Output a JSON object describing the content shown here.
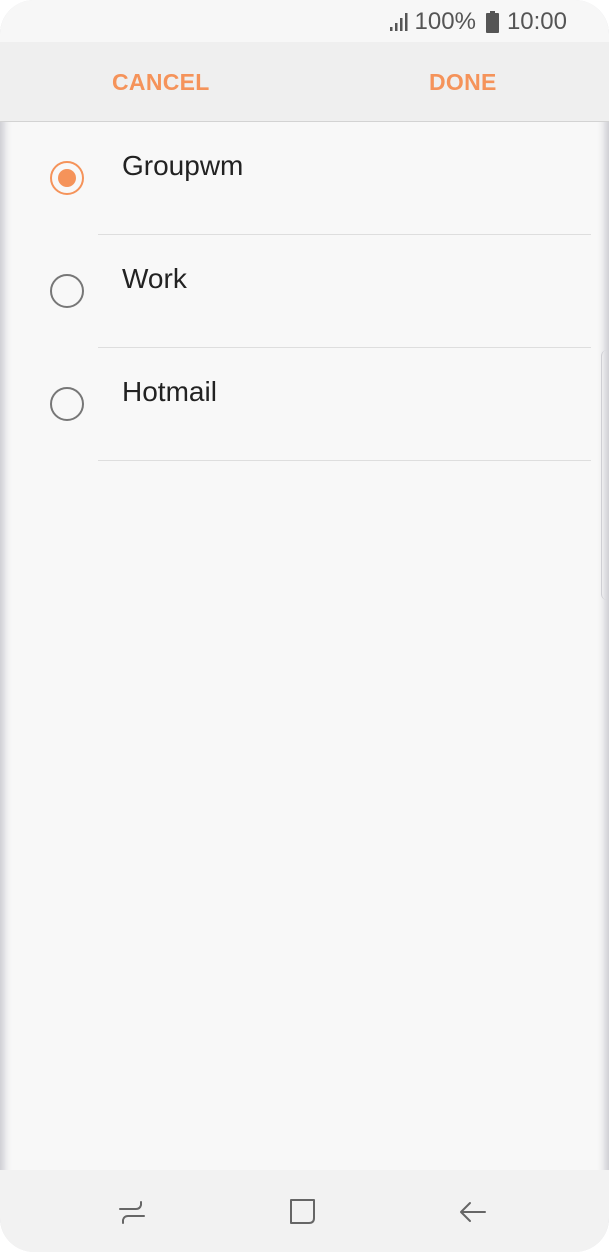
{
  "status_bar": {
    "battery": "100%",
    "time": "10:00",
    "signal_icon": "signal-icon",
    "battery_icon": "battery-icon"
  },
  "action_bar": {
    "cancel_label": "CANCEL",
    "done_label": "DONE"
  },
  "accounts": [
    {
      "label": "Groupwm",
      "selected": true
    },
    {
      "label": "Work",
      "selected": false
    },
    {
      "label": "Hotmail",
      "selected": false
    }
  ],
  "nav_bar": {
    "icons": [
      "recents-icon",
      "home-icon",
      "back-icon"
    ]
  },
  "colors": {
    "accent": "#f5935a",
    "background": "#f8f8f8",
    "text": "#222222"
  }
}
